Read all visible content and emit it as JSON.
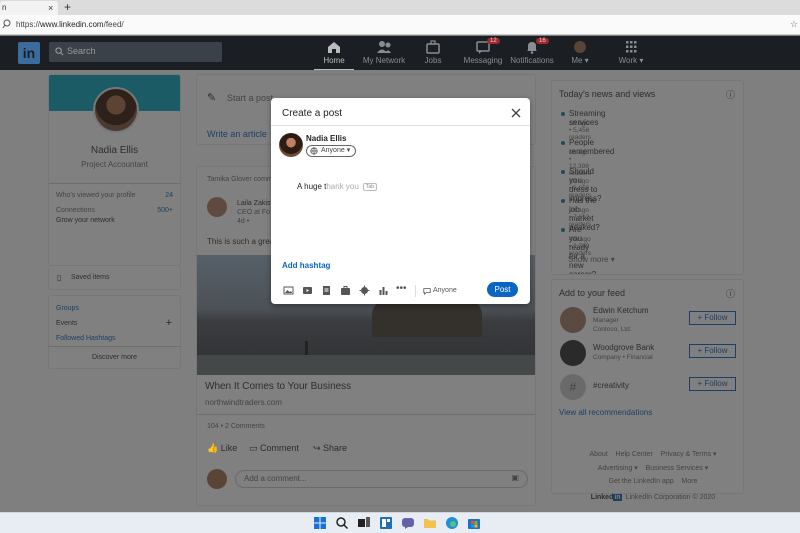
{
  "browser": {
    "tab_title": "n",
    "tab_close": "×",
    "new_tab": "+",
    "url_prefix": "https://",
    "url_host": "www.linkedin.com",
    "url_path": "/feed/"
  },
  "nav": {
    "logo": "in",
    "search_placeholder": "Search",
    "items": [
      {
        "label": "Home",
        "icon": "home-icon"
      },
      {
        "label": "My Network",
        "icon": "network-icon"
      },
      {
        "label": "Jobs",
        "icon": "briefcase-icon"
      },
      {
        "label": "Messaging",
        "icon": "message-icon",
        "badge": "12"
      },
      {
        "label": "Notifications",
        "icon": "bell-icon",
        "badge": "16"
      },
      {
        "label": "Me",
        "icon": "avatar-icon"
      },
      {
        "label": "Work",
        "icon": "grid-icon"
      }
    ]
  },
  "profile": {
    "name": "Nadia Ellis",
    "title": "Project Accountant",
    "stats": [
      {
        "label": "Who's viewed your profile",
        "value": "24"
      },
      {
        "label": "Connections",
        "value": "500+"
      }
    ],
    "grow": "Grow your network",
    "saved": "Saved items",
    "links": [
      "Groups",
      "Events",
      "Followed Hashtags"
    ],
    "discover": "Discover more"
  },
  "start_post": {
    "label": "Start a post",
    "write_article": "Write an article"
  },
  "feed_post": {
    "header": "Tamika Glover comm...",
    "author": "Laila Zakis",
    "author_title": "CEO at Fo...",
    "time": "4d • ",
    "text": "This is such a great...",
    "link_title": "When It Comes to Your Business",
    "link_domain": "northwindtraders.com",
    "reactions": "104 • 2 Comments",
    "actions": [
      "Like",
      "Comment",
      "Share"
    ],
    "comment_placeholder": "Add a comment..."
  },
  "news": {
    "title": "Today's news and views",
    "items": [
      {
        "headline": "Streaming services",
        "meta": "1h ago • 5,456 readers"
      },
      {
        "headline": "People remembered",
        "meta": "1h ago • 12,398 readers"
      },
      {
        "headline": "Should you dress to impress?",
        "meta": "1h ago • 5,656 readers"
      },
      {
        "headline": "Has the job market peaked?",
        "meta": "2h ago • 7,612 readers"
      },
      {
        "headline": "Are you ready for a new career?",
        "meta": "4m ago • 2,789 readers"
      }
    ],
    "show_more": "Show more"
  },
  "feed_suggest": {
    "title": "Add to your feed",
    "items": [
      {
        "name": "Edwin Ketchum",
        "sub1": "Manager",
        "sub2": "Contoso, Ltd."
      },
      {
        "name": "Woodgrove Bank",
        "sub1": "Company • Financial",
        "sub2": ""
      },
      {
        "name": "#creativity",
        "sub1": "",
        "sub2": ""
      }
    ],
    "follow": "+ Follow",
    "view_all": "View all recommendations"
  },
  "footer": {
    "row1": [
      "About",
      "Help Center",
      "Privacy & Terms"
    ],
    "row2": [
      "Advertising",
      "Business Services"
    ],
    "row3": [
      "Get the LinkedIn app",
      "More"
    ],
    "brand": "Linked",
    "brand_in": "in",
    "copyright": "LinkedIn Corporation © 2020"
  },
  "modal": {
    "title": "Create a post",
    "name": "Nadia Ellis",
    "audience": "Anyone",
    "typed": "A huge t",
    "suggestion": "hank you",
    "tab_hint": "Tab",
    "add_hashtag": "Add hashtag",
    "visibility": "Anyone",
    "post_button": "Post"
  },
  "colors": {
    "accent": "#0a66c2",
    "nav_bg": "#1b1f23"
  }
}
